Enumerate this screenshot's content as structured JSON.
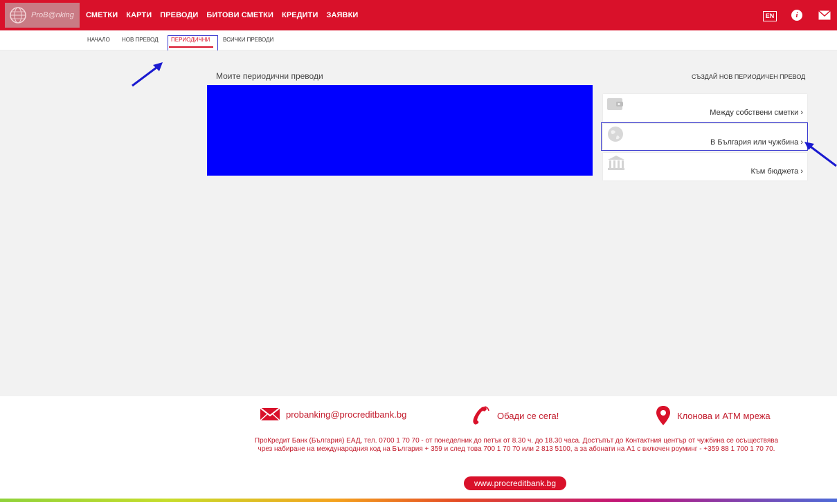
{
  "app": {
    "logo_text": "ProB@nking"
  },
  "colors": {
    "brand_red": "#d9112a",
    "annotation_blue": "#0000ff",
    "main_bg": "#f2f2f2"
  },
  "main_nav": [
    "СМЕТКИ",
    "КАРТИ",
    "ПРЕВОДИ",
    "БИТОВИ СМЕТКИ",
    "КРЕДИТИ",
    "ЗАЯВКИ"
  ],
  "header_right": {
    "lang": "EN",
    "info_icon": "info-icon",
    "mail_icon": "mail-icon"
  },
  "sub_nav": [
    "НАЧАЛО",
    "НОВ ПРЕВОД",
    "ПЕРИОДИЧНИ",
    "ВСИЧКИ ПРЕВОДИ"
  ],
  "content": {
    "section_title": "Моите периодични преводи",
    "create_title": "СЪЗДАЙ НОВ ПЕРИОДИЧЕН ПРЕВОД",
    "options": [
      {
        "label": "Между собствени сметки ›",
        "icon": "wallet-icon"
      },
      {
        "label": "В България или чужбина ›",
        "icon": "globe-icon"
      },
      {
        "label": "Към бюджета ›",
        "icon": "building-icon"
      }
    ]
  },
  "footer": {
    "email": "probanking@procreditbank.bg",
    "call": "Обади се сега!",
    "branches": "Клонова и АТМ мрежа",
    "info_text": "ПроКредит Банк (България) ЕАД, тел. 0700 1 70 70 - от понеделник до петък от 8.30 ч. до 18.30 часа. Достъпът до Контактния център от чужбина се осъществява чрез набиране на международния код на България + 359 и след това 700 1 70 70 или 2 813 5100, а за абонати на А1 с включен роуминг - +359 88 1 700 1 70 70.",
    "website": "www.procreditbank.bg"
  }
}
